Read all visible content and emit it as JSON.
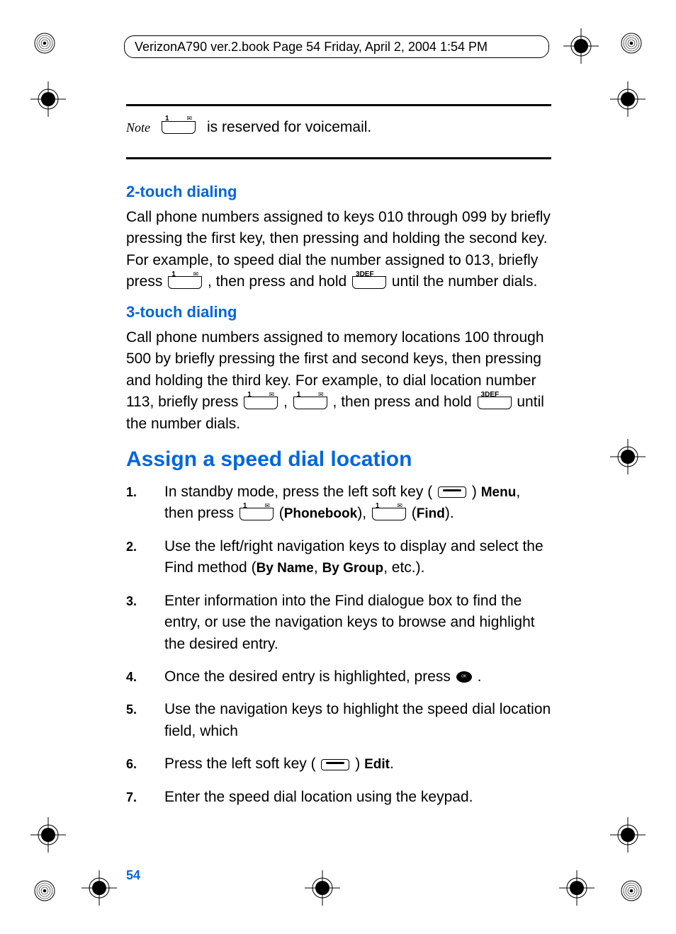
{
  "header": "VerizonA790 ver.2.book  Page 54  Friday, April 2, 2004  1:54 PM",
  "note": {
    "icon_label": "Note",
    "text": " is reserved for voicemail."
  },
  "sections": {
    "twoTouch": {
      "title": "2-touch dialing",
      "p1": "Call phone numbers assigned to keys 010 through 099 by briefly pressing the first key, then pressing and holding the second key. For example, to speed dial the number assigned to 013, briefly press ",
      "p2": ", then press and hold ",
      "p3": " until the number dials."
    },
    "threeTouch": {
      "title": "3-touch dialing",
      "p1": "Call phone numbers assigned to memory locations 100 through 500 by briefly pressing the first and second keys, then pressing and holding the third key. For example, to dial location number 113, briefly press ",
      "p2": ", ",
      "p3": ", then press and hold ",
      "p4": " until the number dials."
    },
    "assign": {
      "title": "Assign a speed dial location",
      "steps": {
        "s1a": "In standby mode, press the left soft key (",
        "s1b": ") ",
        "s1_menu": "Menu",
        "s1c": ", then press ",
        "s1d": " (",
        "s1_phonebook": "Phonebook",
        "s1e": "), ",
        "s1f": " (",
        "s1_find": "Find",
        "s1g": ").",
        "s2a": "Use the left/right navigation keys to display and select the Find method (",
        "s2_byname": "By Name",
        "s2b": ", ",
        "s2_bygroup": "By Group",
        "s2c": ", etc.).",
        "s3": "Enter information into the Find dialogue box to find the entry, or use the navigation keys to browse and highlight the desired entry.",
        "s4a": "Once the desired entry is highlighted, press ",
        "s4b": ".",
        "s5": "Use the navigation keys to highlight the speed dial location field, which",
        "s6a": "Press the left soft key (",
        "s6b": ") ",
        "s6_edit": "Edit",
        "s6c": ".",
        "s7": "Enter the speed dial location using the keypad."
      }
    }
  },
  "pageNumber": "54"
}
